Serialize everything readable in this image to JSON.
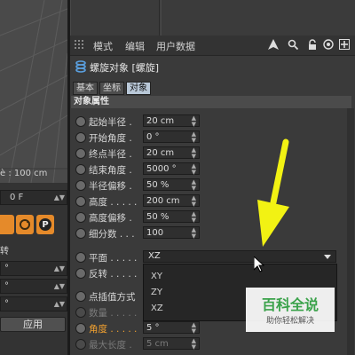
{
  "viewport": {
    "status_text": "è : 100 cm"
  },
  "left_panel": {
    "frame_field": "0 F",
    "tool_icons": [
      "tool-icon-1",
      "rotate-icon",
      "p-icon"
    ],
    "tool_letter": "P",
    "partial_label": "转",
    "fields": [
      "°",
      "°",
      "°"
    ],
    "apply_label": "应用"
  },
  "menubar": {
    "items": [
      "模式",
      "编辑",
      "用户数据"
    ],
    "icons": [
      "arrow-icon",
      "search-icon",
      "lock-icon",
      "target-icon",
      "new-panel-icon"
    ]
  },
  "object": {
    "title": "螺旋对象 [螺旋]",
    "tabs": [
      "基本",
      "坐标",
      "对象"
    ],
    "active_tab": "对象",
    "section_title": "对象属性"
  },
  "properties": [
    {
      "label": "起始半径 .",
      "value": "20 cm"
    },
    {
      "label": "开始角度 .",
      "value": "0 °"
    },
    {
      "label": "终点半径 .",
      "value": "20 cm"
    },
    {
      "label": "结束角度 .",
      "value": "5000 °"
    },
    {
      "label": "半径偏移 .",
      "value": "50 %"
    },
    {
      "label": "高度 . . . . .",
      "value": "200 cm"
    },
    {
      "label": "高度偏移 .",
      "value": "50 %"
    },
    {
      "label": "细分数 . . .",
      "value": "100"
    }
  ],
  "plane": {
    "label": "平面 . . . . .",
    "value": "XZ",
    "options": [
      "XY",
      "ZY",
      "XZ"
    ]
  },
  "reverse": {
    "label": "反转 . . . . ."
  },
  "interpolation": {
    "label": "点插值方式"
  },
  "count": {
    "label": "数量 . . . . ."
  },
  "angle": {
    "label": "角度 . . . . .",
    "value": "5 °"
  },
  "max_length": {
    "label": "最大长度 .",
    "value": "5 cm"
  },
  "watermark": {
    "title": "百科全说",
    "subtitle": "助你轻松解决"
  },
  "colors": {
    "annotation_arrow": "#f2f213",
    "accent_label": "#f0a030",
    "active_tab": "#b9c8d8",
    "tool_orange": "#e58a2a"
  }
}
